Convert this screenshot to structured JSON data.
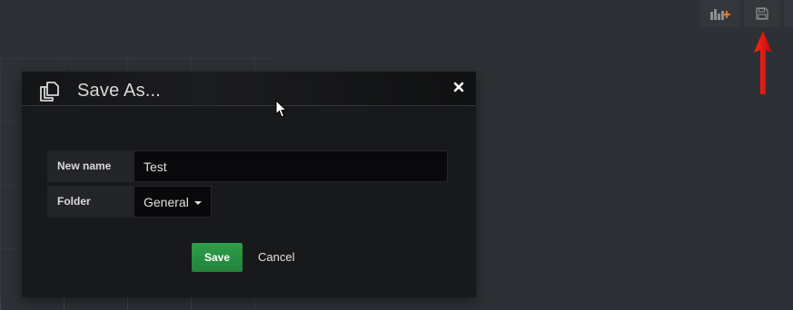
{
  "toolbar": {
    "add_panel_icon": "bar-chart-plus-icon",
    "save_icon": "floppy-disk-icon"
  },
  "annotation": {
    "arrow_color": "#e8100e",
    "arrow_icon": "red-up-arrow"
  },
  "modal": {
    "title": "Save As...",
    "title_icon": "copy-icon",
    "close_icon": "close-icon",
    "fields": {
      "name_label": "New name",
      "name_value": "Test",
      "folder_label": "Folder",
      "folder_value": "General"
    },
    "buttons": {
      "save_label": "Save",
      "cancel_label": "Cancel"
    }
  },
  "colors": {
    "background": "#2d3035",
    "modal_background": "#18191b",
    "save_button": "#299c46",
    "accent_orange": "#eb7b18"
  }
}
